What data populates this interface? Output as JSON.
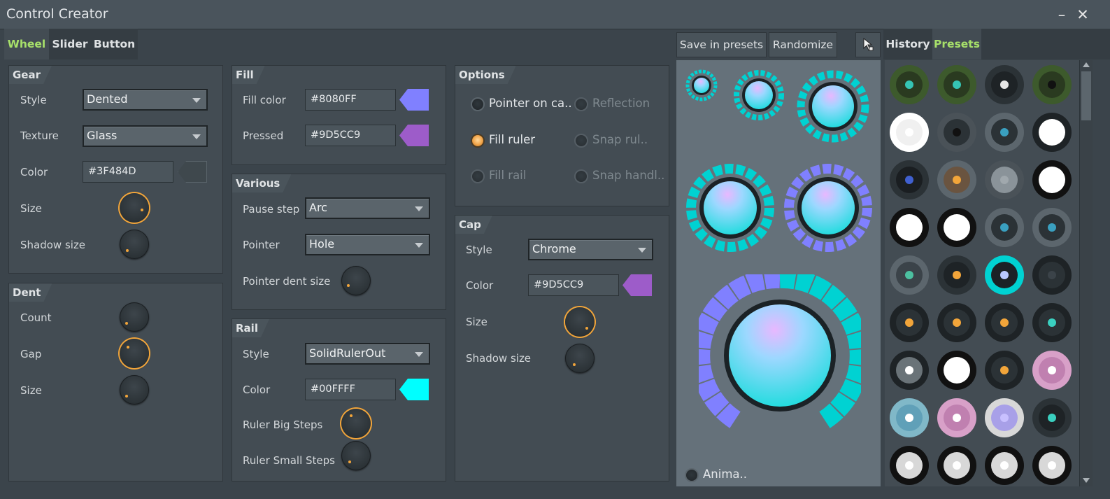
{
  "window": {
    "title": "Control Creator",
    "minimize_glyph": "–",
    "close_glyph": "✕"
  },
  "tabs": [
    "Wheel",
    "Slider",
    "Button"
  ],
  "active_tab": "Wheel",
  "gear": {
    "title": "Gear",
    "style_label": "Style",
    "style_value": "Dented",
    "texture_label": "Texture",
    "texture_value": "Glass",
    "color_label": "Color",
    "color_value": "#3F484D",
    "size_label": "Size",
    "shadow_label": "Shadow size"
  },
  "dent": {
    "title": "Dent",
    "count_label": "Count",
    "gap_label": "Gap",
    "size_label": "Size"
  },
  "fill": {
    "title": "Fill",
    "fill_color_label": "Fill color",
    "fill_color_value": "#8080FF",
    "pressed_label": "Pressed",
    "pressed_value": "#9D5CC9"
  },
  "various": {
    "title": "Various",
    "pause_step_label": "Pause step",
    "pause_step_value": "Arc",
    "pointer_label": "Pointer",
    "pointer_value": "Hole",
    "pointer_dent_label": "Pointer dent size"
  },
  "rail": {
    "title": "Rail",
    "style_label": "Style",
    "style_value": "SolidRulerOut",
    "color_label": "Color",
    "color_value": "#00FFFF",
    "big_steps_label": "Ruler Big Steps",
    "small_steps_label": "Ruler Small Steps"
  },
  "options": {
    "title": "Options",
    "items": [
      {
        "label": "Pointer on ca..",
        "checked": false,
        "enabled": true
      },
      {
        "label": "Reflection",
        "checked": false,
        "enabled": false
      },
      {
        "label": "Fill ruler",
        "checked": true,
        "enabled": true
      },
      {
        "label": "Snap rul..",
        "checked": false,
        "enabled": false
      },
      {
        "label": "Fill rail",
        "checked": false,
        "enabled": false
      },
      {
        "label": "Snap handl..",
        "checked": false,
        "enabled": false
      }
    ]
  },
  "cap": {
    "title": "Cap",
    "style_label": "Style",
    "style_value": "Chrome",
    "color_label": "Color",
    "color_value": "#9D5CC9",
    "size_label": "Size",
    "shadow_label": "Shadow size"
  },
  "toolbar": {
    "save_label": "Save in presets",
    "randomize_label": "Randomize",
    "cursor_icon": "pointer-cursor-icon"
  },
  "preview": {
    "animate_label": "Anima.."
  },
  "side_tabs": [
    "History",
    "Presets"
  ],
  "active_side_tab": "Presets",
  "colors": {
    "accent_green": "#a7e06a",
    "knob_orange": "#f2a53a",
    "cyan": "#00FFFF",
    "lavender": "#8080FF",
    "purple": "#9D5CC9"
  },
  "preset_icons": [
    "green-flower-knob",
    "green-flower-knob",
    "tick-ring-knob",
    "green-flower-black-knob",
    "white-disc-knob",
    "dark-pointer-knob",
    "ticked-dark-knob",
    "white-gear-knob",
    "square-dark-knob",
    "bronze-knob",
    "grey-knob",
    "white-ring-knob",
    "white-arc-knob",
    "white-arc-knob",
    "ticked-dark-knob",
    "ticked-dark-knob",
    "grey-ring-knob",
    "dark-ticked-knob",
    "cyan-gradient-knob",
    "dark-arc-knob",
    "dark-knob",
    "dark-knob",
    "orange-pointer-knob",
    "dark-cyan-knob",
    "ticked-chrome-knob",
    "white-center-knob",
    "dark-knob",
    "pink-flower-knob",
    "blue-flower-knob",
    "pink-flower-knob",
    "lavender-star-knob",
    "dark-star-knob",
    "chrome-spiked-knob",
    "chrome-spiked-knob",
    "chrome-spiked-knob",
    "chrome-spiked-knob"
  ]
}
